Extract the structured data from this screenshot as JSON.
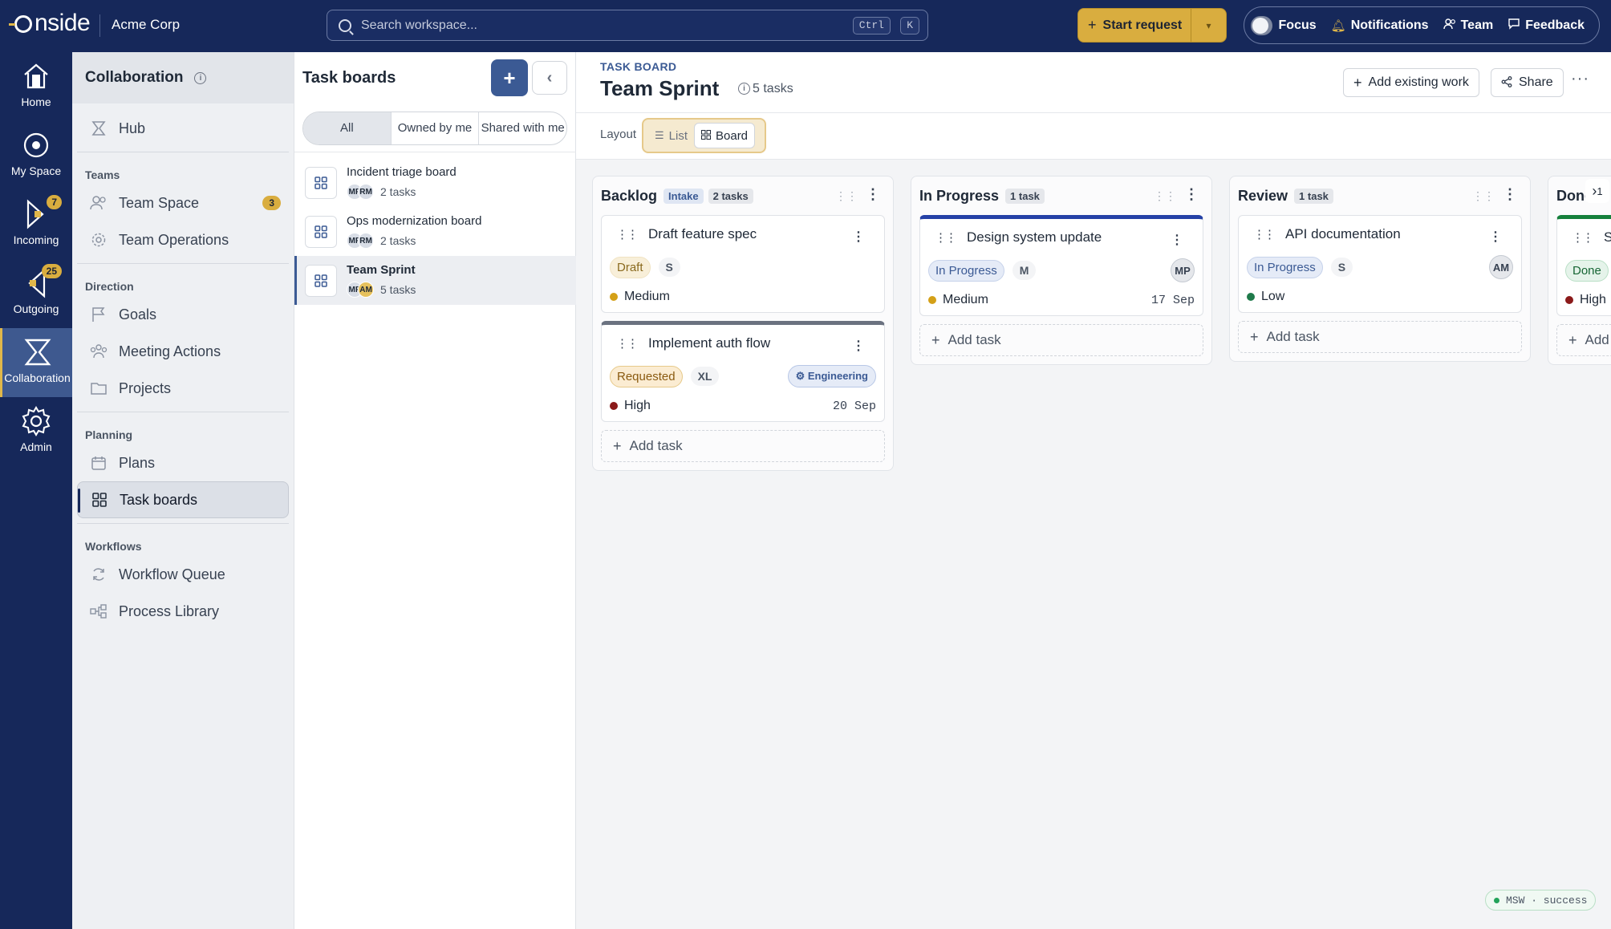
{
  "topbar": {
    "logo": "nside",
    "org": "Acme Corp",
    "search_placeholder": "Search workspace...",
    "kbd_ctrl": "Ctrl",
    "kbd_k": "K",
    "start_request": "Start request",
    "focus": "Focus",
    "notifications": "Notifications",
    "team": "Team",
    "feedback": "Feedback"
  },
  "rail": {
    "items": [
      {
        "label": "Home",
        "icon": "home-icon"
      },
      {
        "label": "My Space",
        "icon": "target-icon"
      },
      {
        "label": "Incoming",
        "icon": "incoming-icon",
        "badge": "7"
      },
      {
        "label": "Outgoing",
        "icon": "outgoing-icon",
        "badge": "25"
      },
      {
        "label": "Collaboration",
        "icon": "hourglass-icon",
        "active": true
      },
      {
        "label": "Admin",
        "icon": "gear-icon"
      }
    ]
  },
  "subnav": {
    "title": "Collaboration",
    "hub": "Hub",
    "sections": {
      "teams": "Teams",
      "direction": "Direction",
      "planning": "Planning",
      "workflows": "Workflows"
    },
    "team_space": "Team Space",
    "team_space_badge": "3",
    "team_operations": "Team Operations",
    "goals": "Goals",
    "meeting_actions": "Meeting Actions",
    "projects": "Projects",
    "plans": "Plans",
    "task_boards": "Task boards",
    "workflow_queue": "Workflow Queue",
    "process_library": "Process Library"
  },
  "boards": {
    "title": "Task boards",
    "filters": [
      "All",
      "Owned by me",
      "Shared with me"
    ],
    "list": [
      {
        "name": "Incident triage board",
        "count": "2 tasks",
        "avatars": [
          "MP",
          "RM"
        ]
      },
      {
        "name": "Ops modernization board",
        "count": "2 tasks",
        "avatars": [
          "MP",
          "RM"
        ]
      },
      {
        "name": "Team Sprint",
        "count": "5 tasks",
        "avatars": [
          "MP",
          "AM"
        ]
      }
    ]
  },
  "main": {
    "eyebrow": "TASK BOARD",
    "title": "Team Sprint",
    "task_count": "5 tasks",
    "add_existing": "Add existing work",
    "share": "Share",
    "more": "···",
    "layout_label": "Layout",
    "layout_list": "List",
    "layout_board": "Board",
    "add_task": "Add task",
    "status_chip": "MSW · success"
  },
  "columns": [
    {
      "name": "Backlog",
      "tag": "Intake",
      "count": "2 tasks",
      "cards": [
        {
          "title": "Draft feature spec",
          "status": "Draft",
          "size": "S",
          "priority": "Medium"
        },
        {
          "title": "Implement auth flow",
          "status": "Requested",
          "size": "XL",
          "team": "Engineering",
          "priority": "High",
          "due": "20 Sep"
        }
      ]
    },
    {
      "name": "In Progress",
      "count": "1 task",
      "cards": [
        {
          "title": "Design system update",
          "status": "In Progress",
          "size": "M",
          "assignee": "MP",
          "priority": "Medium",
          "due": "17 Sep"
        }
      ]
    },
    {
      "name": "Review",
      "count": "1 task",
      "cards": [
        {
          "title": "API documentation",
          "status": "In Progress",
          "size": "S",
          "assignee": "AM",
          "priority": "Low"
        }
      ]
    },
    {
      "name": "Done",
      "count": "1",
      "cards": [
        {
          "title": "Se",
          "status": "Done",
          "priority": "High"
        }
      ]
    }
  ],
  "colors": {
    "navy": "#16285a",
    "gold": "#d9ad3f",
    "accent_blue": "#3b5a94",
    "priority_medium": "#d4a017",
    "priority_high": "#8b1a1a",
    "priority_low": "#1f7a4a"
  }
}
